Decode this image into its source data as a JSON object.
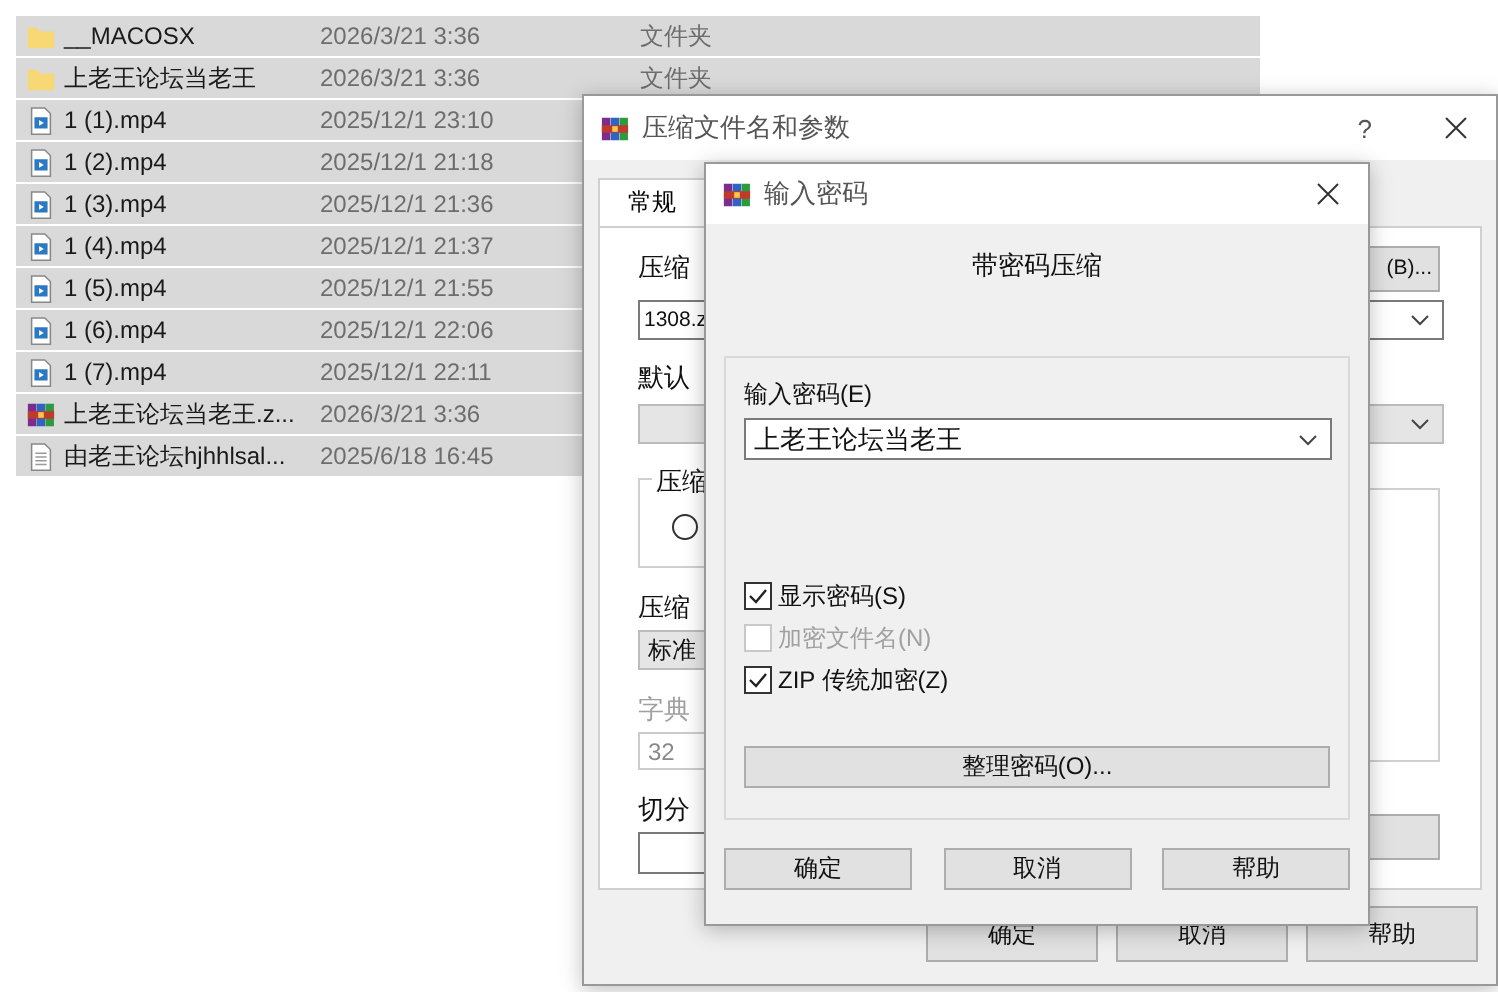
{
  "files": [
    {
      "kind": "folder",
      "name": "__MACOSX",
      "date": "2026/3/21 3:36",
      "type": "文件夹",
      "selected": true
    },
    {
      "kind": "folder",
      "name": "上老王论坛当老王",
      "date": "2026/3/21 3:36",
      "type": "文件夹",
      "selected": true
    },
    {
      "kind": "video",
      "name": "1 (1).mp4",
      "date": "2025/12/1 23:10",
      "selected": true
    },
    {
      "kind": "video",
      "name": "1 (2).mp4",
      "date": "2025/12/1 21:18",
      "selected": true
    },
    {
      "kind": "video",
      "name": "1 (3).mp4",
      "date": "2025/12/1 21:36",
      "selected": true
    },
    {
      "kind": "video",
      "name": "1 (4).mp4",
      "date": "2025/12/1 21:37",
      "selected": true
    },
    {
      "kind": "video",
      "name": "1 (5).mp4",
      "date": "2025/12/1 21:55",
      "selected": true
    },
    {
      "kind": "video",
      "name": "1 (6).mp4",
      "date": "2025/12/1 22:06",
      "selected": true
    },
    {
      "kind": "video",
      "name": "1 (7).mp4",
      "date": "2025/12/1 22:11",
      "selected": true
    },
    {
      "kind": "archive",
      "name": "上老王论坛当老王.z...",
      "date": "2026/3/21 3:36",
      "selected": true
    },
    {
      "kind": "text",
      "name": "由老王论坛hjhhlsal...",
      "date": "2025/6/18 16:45",
      "selected": true
    }
  ],
  "archive_dialog": {
    "title": "压缩文件名和参数",
    "help": "?",
    "tabs": [
      {
        "label": "常规",
        "selected": true
      }
    ],
    "archive_name_label": "压缩",
    "browse_button": "(B)...",
    "archive_name_value": "1308.z",
    "profile_label": "默认",
    "format_group_label": "压缩",
    "format_radio": {
      "selected": false
    },
    "compression_label": "压缩",
    "compression_value": "标准",
    "dictionary_label": "字典",
    "dictionary_value": "32",
    "split_label": "切分",
    "buttons": [
      "确定",
      "取消",
      "帮助"
    ]
  },
  "password_dialog": {
    "title": "输入密码",
    "heading": "带密码压缩",
    "password_label": "输入密码(E)",
    "password_value": "上老王论坛当老王",
    "options": [
      {
        "label": "显示密码(S)",
        "checked": true,
        "disabled": false
      },
      {
        "label": "加密文件名(N)",
        "checked": false,
        "disabled": true
      },
      {
        "label": "ZIP 传统加密(Z)",
        "checked": true,
        "disabled": false
      }
    ],
    "organize_button": "整理密码(O)...",
    "buttons": [
      "确定",
      "取消",
      "帮助"
    ]
  }
}
